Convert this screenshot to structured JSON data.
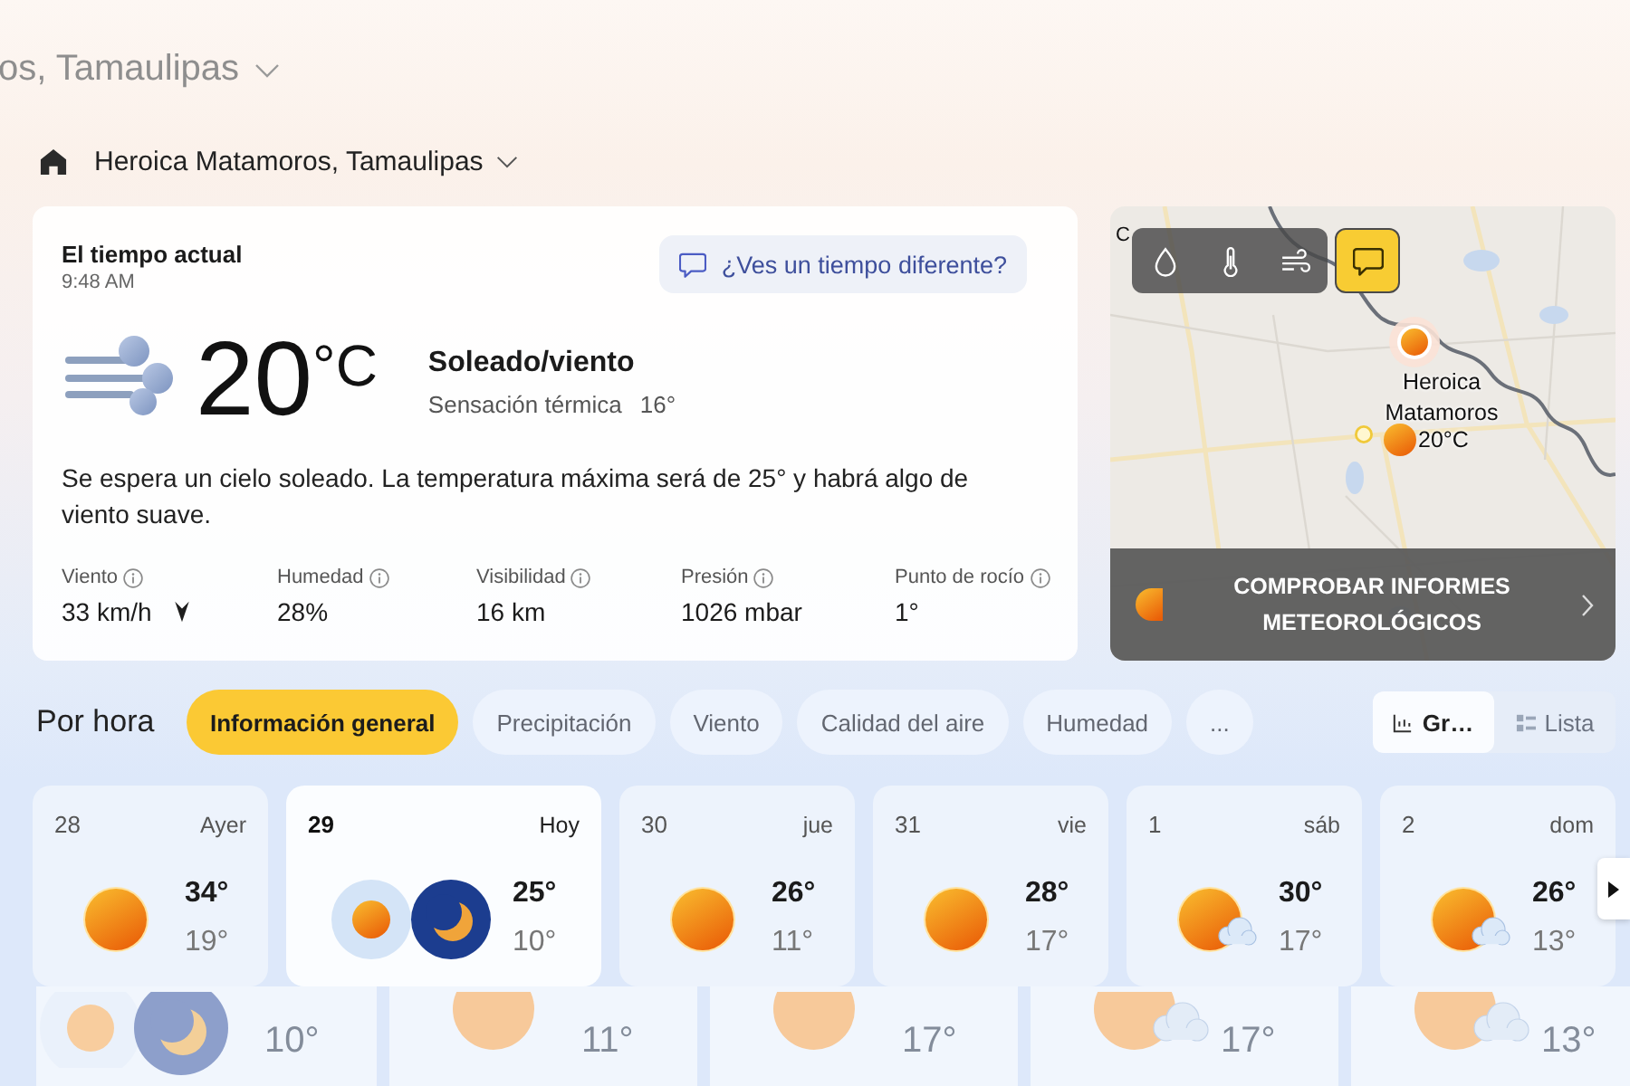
{
  "ghost_header": {
    "text": "os, Tamaulipas"
  },
  "location": {
    "name": "Heroica Matamoros, Tamaulipas"
  },
  "current": {
    "title": "El tiempo actual",
    "time": "9:48 AM",
    "feedback_button": "¿Ves un tiempo diferente?",
    "temperature": "20",
    "unit": "°C",
    "condition": "Soleado/viento",
    "feels_like_label": "Sensación térmica",
    "feels_like": "16°",
    "summary": "Se espera un cielo soleado. La temperatura máxima será de 25° y habrá algo de viento suave.",
    "stats": [
      {
        "label": "Viento",
        "value": "33 km/h",
        "kind": "wind"
      },
      {
        "label": "Humedad",
        "value": "28%",
        "kind": "plain"
      },
      {
        "label": "Visibilidad",
        "value": "16 km",
        "kind": "plain"
      },
      {
        "label": "Presión",
        "value": "1026 mbar",
        "kind": "plain"
      },
      {
        "label": "Punto de rocío",
        "value": "1°",
        "kind": "plain"
      }
    ]
  },
  "map": {
    "corner_label": "C",
    "layers": [
      {
        "kind": "precipitation",
        "selected": false
      },
      {
        "kind": "temperature",
        "selected": false
      },
      {
        "kind": "wind",
        "selected": false
      },
      {
        "kind": "comments",
        "selected": true
      }
    ],
    "place": "Heroica Matamoros",
    "place_temp": "20°C",
    "banner": "COMPROBAR INFORMES METEOROLÓGICOS"
  },
  "hourly": {
    "title": "Por hora",
    "tabs": [
      {
        "label": "Información general",
        "selected": true
      },
      {
        "label": "Precipitación",
        "selected": false
      },
      {
        "label": "Viento",
        "selected": false
      },
      {
        "label": "Calidad del aire",
        "selected": false
      },
      {
        "label": "Humedad",
        "selected": false
      },
      {
        "label": "...",
        "selected": false
      }
    ],
    "views": [
      {
        "kind": "chart",
        "label": "Gr…",
        "selected": true
      },
      {
        "kind": "list",
        "label": "Lista",
        "selected": false
      }
    ]
  },
  "days": [
    {
      "date": "28",
      "day": "Ayer",
      "kind": "sunny",
      "high": "34°",
      "low": "19°",
      "selected": false
    },
    {
      "date": "29",
      "day": "Hoy",
      "kind": "day-night",
      "high": "25°",
      "low": "10°",
      "selected": true
    },
    {
      "date": "30",
      "day": "jue",
      "kind": "sunny",
      "high": "26°",
      "low": "11°",
      "selected": false
    },
    {
      "date": "31",
      "day": "vie",
      "kind": "sunny",
      "high": "28°",
      "low": "17°",
      "selected": false
    },
    {
      "date": "1",
      "day": "sáb",
      "kind": "partly-cloudy",
      "high": "30°",
      "low": "17°",
      "selected": false
    },
    {
      "date": "2",
      "day": "dom",
      "kind": "partly-cloudy",
      "high": "26°",
      "low": "13°",
      "selected": false
    }
  ],
  "ghost_row": [
    {
      "kind": "day-night",
      "low": "10°"
    },
    {
      "kind": "sunny",
      "low": "11°"
    },
    {
      "kind": "sunny",
      "low": "17°"
    },
    {
      "kind": "partly-cloudy",
      "low": "17°"
    },
    {
      "kind": "partly-cloudy",
      "low": "13°"
    }
  ]
}
